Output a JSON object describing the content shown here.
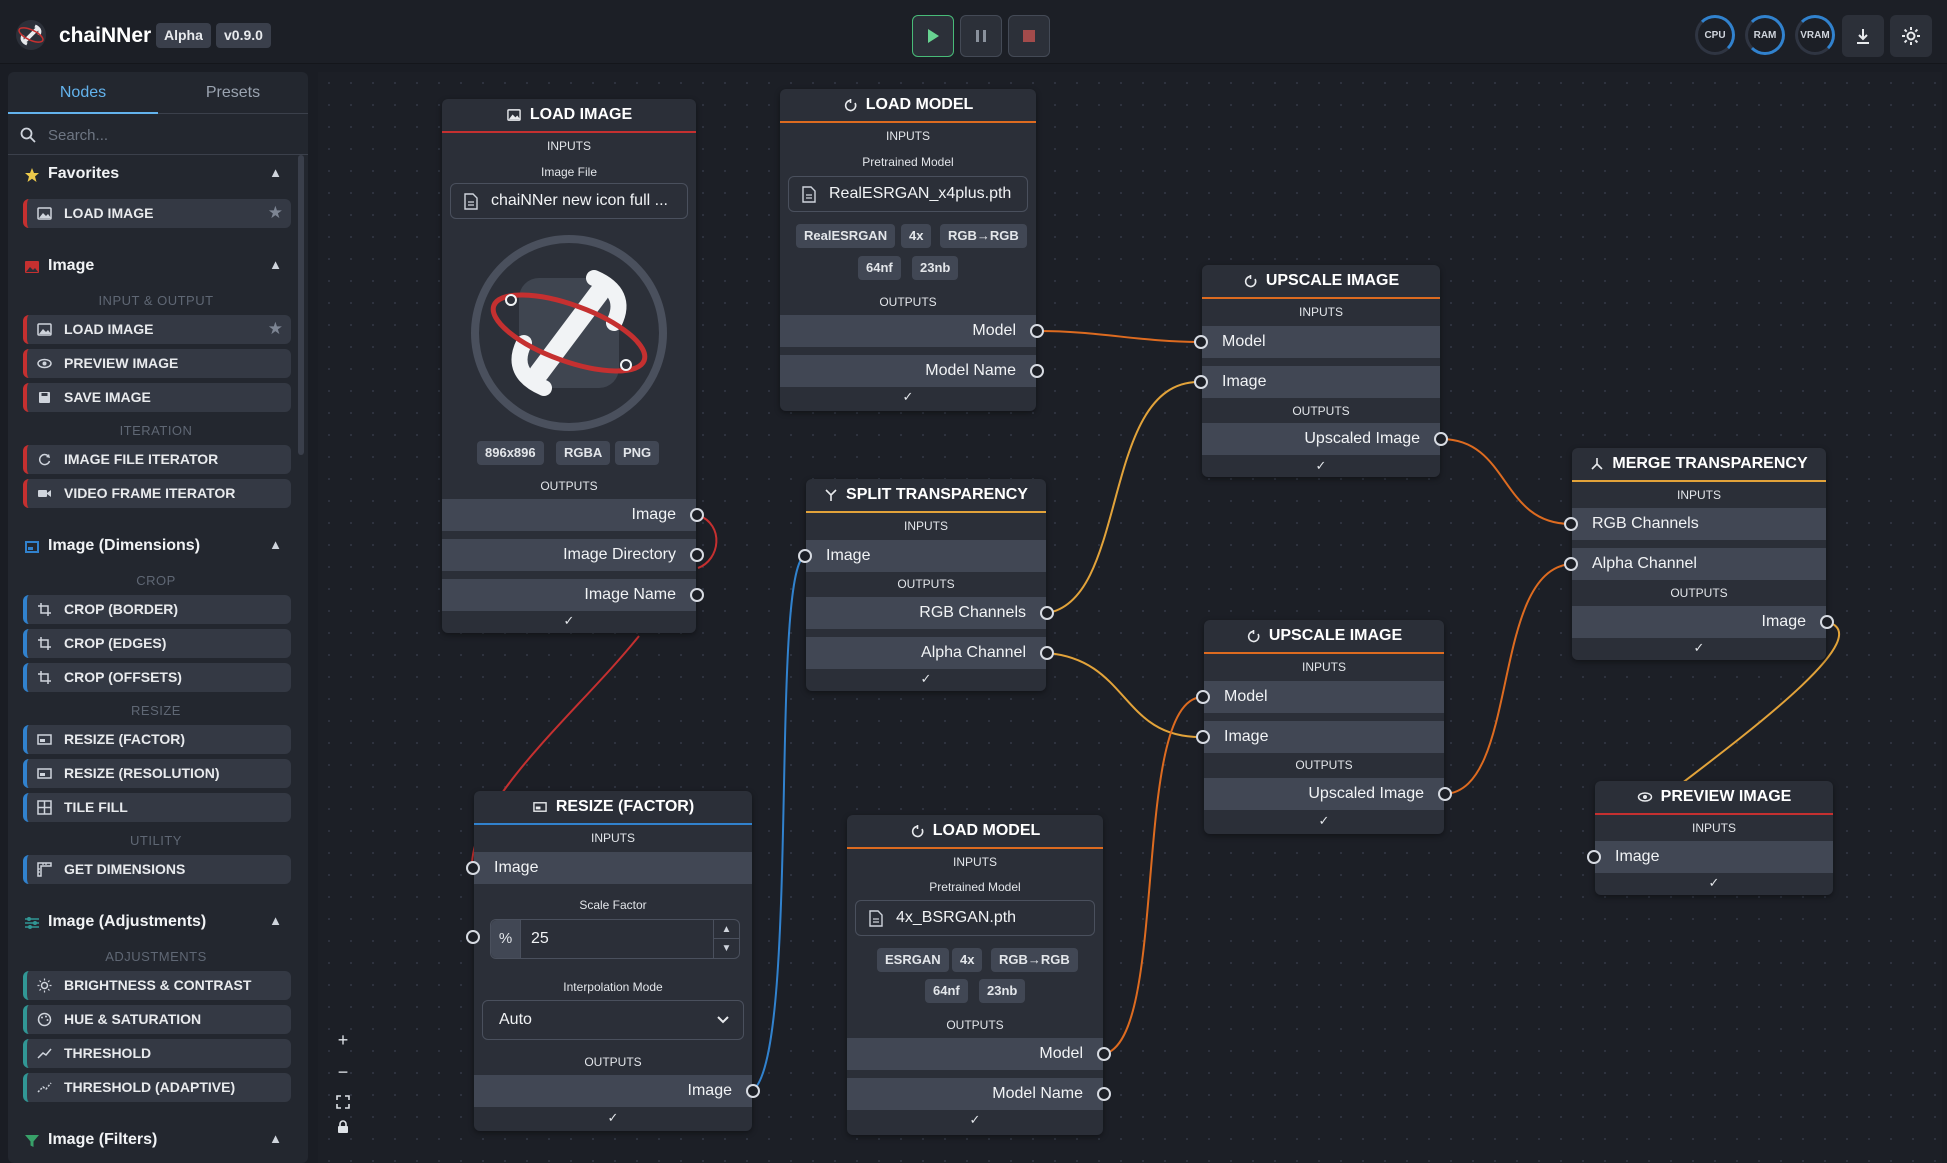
{
  "header": {
    "app_name": "chaiNNer",
    "badge_alpha": "Alpha",
    "badge_version": "v0.9.0",
    "meters": [
      "CPU",
      "RAM",
      "VRAM"
    ],
    "icons": [
      "play-icon",
      "pause-icon",
      "stop-icon",
      "download-icon",
      "gear-icon"
    ]
  },
  "sidebar": {
    "tabs": [
      "Nodes",
      "Presets"
    ],
    "search_placeholder": "Search...",
    "categories": {
      "favorites": "Favorites",
      "image": "Image",
      "image_dimensions": "Image (Dimensions)",
      "image_adjustments": "Image (Adjustments)",
      "image_filters": "Image (Filters)"
    },
    "subheads": {
      "input_output": "INPUT & OUTPUT",
      "iteration": "ITERATION",
      "crop": "CROP",
      "resize": "RESIZE",
      "utility": "UTILITY",
      "adjustments": "ADJUSTMENTS"
    },
    "items": {
      "fav_load_image": "LOAD IMAGE",
      "load_image": "LOAD IMAGE",
      "preview_image": "PREVIEW IMAGE",
      "save_image": "SAVE IMAGE",
      "image_file_iterator": "IMAGE FILE ITERATOR",
      "video_frame_iterator": "VIDEO FRAME ITERATOR",
      "crop_border": "CROP (BORDER)",
      "crop_edges": "CROP (EDGES)",
      "crop_offsets": "CROP (OFFSETS)",
      "resize_factor": "RESIZE (FACTOR)",
      "resize_resolution": "RESIZE (RESOLUTION)",
      "tile_fill": "TILE FILL",
      "get_dimensions": "GET DIMENSIONS",
      "brightness_contrast": "BRIGHTNESS & CONTRAST",
      "hue_saturation": "HUE & SATURATION",
      "threshold": "THRESHOLD",
      "threshold_adaptive": "THRESHOLD (ADAPTIVE)"
    },
    "colors": {
      "image": "#c53030",
      "dimensions": "#3182ce",
      "adjustments": "#319795",
      "filters": "#38a169",
      "star": "#ecc94b"
    }
  },
  "labels": {
    "inputs": "INPUTS",
    "outputs": "OUTPUTS",
    "check": "✓"
  },
  "nodes": {
    "load_image": {
      "title": "LOAD IMAGE",
      "input_label": "Image File",
      "file_value": "chaiNNer new icon full ...",
      "tags": [
        "896x896",
        "RGBA",
        "PNG"
      ],
      "outputs": [
        "Image",
        "Image Directory",
        "Image Name"
      ]
    },
    "load_model_1": {
      "title": "LOAD MODEL",
      "input_label": "Pretrained Model",
      "file_value": "RealESRGAN_x4plus.pth",
      "tags": [
        "RealESRGAN",
        "4x",
        "RGB→RGB",
        "64nf",
        "23nb"
      ],
      "outputs": [
        "Model",
        "Model Name"
      ]
    },
    "upscale_1": {
      "title": "UPSCALE IMAGE",
      "inputs": [
        "Model",
        "Image"
      ],
      "output": "Upscaled Image"
    },
    "split_transparency": {
      "title": "SPLIT TRANSPARENCY",
      "input": "Image",
      "outputs": [
        "RGB Channels",
        "Alpha Channel"
      ]
    },
    "merge_transparency": {
      "title": "MERGE TRANSPARENCY",
      "inputs": [
        "RGB Channels",
        "Alpha Channel"
      ],
      "output": "Image"
    },
    "upscale_2": {
      "title": "UPSCALE IMAGE",
      "inputs": [
        "Model",
        "Image"
      ],
      "output": "Upscaled Image"
    },
    "resize_factor": {
      "title": "RESIZE (FACTOR)",
      "input": "Image",
      "scale_label": "Scale Factor",
      "scale_unit": "%",
      "scale_value": "25",
      "interp_label": "Interpolation Mode",
      "interp_value": "Auto",
      "output": "Image"
    },
    "load_model_2": {
      "title": "LOAD MODEL",
      "input_label": "Pretrained Model",
      "file_value": "4x_BSRGAN.pth",
      "tags": [
        "ESRGAN",
        "4x",
        "RGB→RGB",
        "64nf",
        "23nb"
      ],
      "outputs": [
        "Model",
        "Model Name"
      ]
    },
    "preview_image": {
      "title": "PREVIEW IMAGE",
      "input": "Image"
    }
  },
  "edge_colors": {
    "image": "#e2a33a",
    "model": "#dd6b20",
    "red": "#c53030",
    "blue": "#3182ce"
  }
}
